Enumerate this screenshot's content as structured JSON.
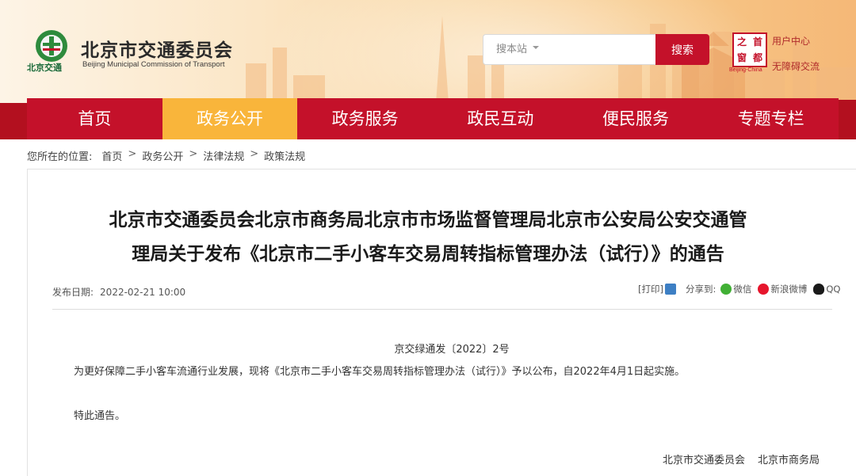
{
  "header": {
    "site_name_cn": "北京市交通委员会",
    "site_name_en": "Beijing Municipal Commission of Transport",
    "logo_sub_label": "北京交通",
    "search": {
      "placeholder": "搜本站",
      "button_label": "搜索"
    },
    "seal": {
      "chars": [
        "之",
        "首",
        "窗",
        "都"
      ],
      "caption": "Beijing-China"
    },
    "user_center": "用户中心",
    "barrier_free": "无障碍交流",
    "colors": {
      "brand_red": "#c4112a",
      "active_tab": "#f9b53b"
    }
  },
  "nav": {
    "items": [
      {
        "label": "首页",
        "active": false
      },
      {
        "label": "政务公开",
        "active": true
      },
      {
        "label": "政务服务",
        "active": false
      },
      {
        "label": "政民互动",
        "active": false
      },
      {
        "label": "便民服务",
        "active": false
      },
      {
        "label": "专题专栏",
        "active": false
      }
    ]
  },
  "breadcrumb": {
    "prefix": "您所在的位置:",
    "items": [
      "首页",
      "政务公开",
      "法律法规",
      "政策法规"
    ],
    "separator": ">"
  },
  "article": {
    "title_line1": "北京市交通委员会北京市商务局北京市市场监督管理局北京市公安局公安交通管",
    "title_line2": "理局关于发布《北京市二手小客车交易周转指标管理办法（试行）》的通告",
    "date_label": "发布日期:",
    "date_value": "2022-02-21 10:00",
    "print_label": "[打印]",
    "share_label": "分享到:",
    "share_targets": [
      "微信",
      "新浪微博",
      "QQ"
    ],
    "doc_number": "京交绿通发〔2022〕2号",
    "body": "为更好保障二手小客车流通行业发展，现将《北京市二手小客车交易周转指标管理办法（试行）》予以公布，自2022年4月1日起实施。",
    "closing": "特此通告。",
    "signatories": [
      "北京市交通委员会",
      "北京市商务局"
    ]
  }
}
